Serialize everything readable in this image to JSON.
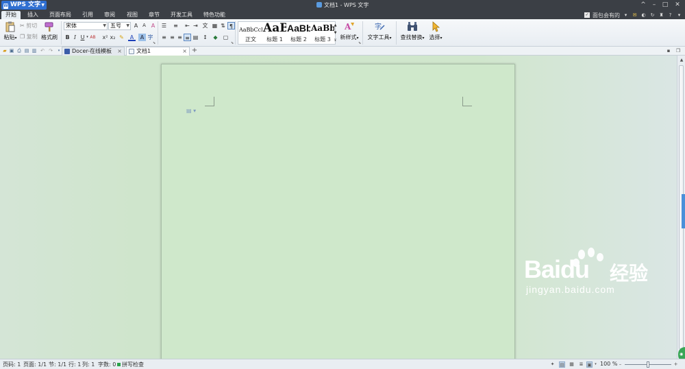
{
  "titlebar": {
    "app_name": "WPS 文字",
    "logo_mark": "W",
    "doc_title": "文档1 - WPS 文字",
    "controls": [
      "^",
      "–",
      "□",
      "✕"
    ]
  },
  "menubar": {
    "items": [
      "开始",
      "插入",
      "页面布局",
      "引用",
      "审阅",
      "视图",
      "章节",
      "开发工具",
      "特色功能"
    ],
    "active_index": 0,
    "right_label": "面包会有的"
  },
  "ribbon": {
    "clipboard": {
      "paste": "粘贴",
      "cut": "剪切",
      "copy": "复制",
      "format_painter": "格式刷"
    },
    "font": {
      "name": "宋体",
      "size": "五号"
    },
    "styles": [
      {
        "sample": "AaBbCcDd",
        "name": "正文"
      },
      {
        "sample": "AaB",
        "name": "标题 1"
      },
      {
        "sample": "AaBb",
        "name": "标题 2"
      },
      {
        "sample": "AaBbC",
        "name": "标题 3"
      }
    ],
    "new_style": "新样式",
    "text_tools": "文字工具",
    "find_replace": "查找替换",
    "select": "选择"
  },
  "tabs": [
    {
      "label": "Docer-在线模板",
      "active": false
    },
    {
      "label": "文档1",
      "active": true
    }
  ],
  "statusbar": {
    "page_code": "页码: 1",
    "page": "页面: 1/1",
    "section": "节: 1/1",
    "row": "行: 1",
    "col": "列: 1",
    "word_count": "字数: 0",
    "spell_check": "拼写检查",
    "zoom": "100 %"
  },
  "watermark": {
    "brand": "Baidu",
    "cn": "经验",
    "url": "jingyan.baidu.com"
  },
  "colors": {
    "titlebar_bg": "#3b3f45",
    "accent_blue": "#2f6fd1",
    "page_green": "#cfe8cb"
  }
}
